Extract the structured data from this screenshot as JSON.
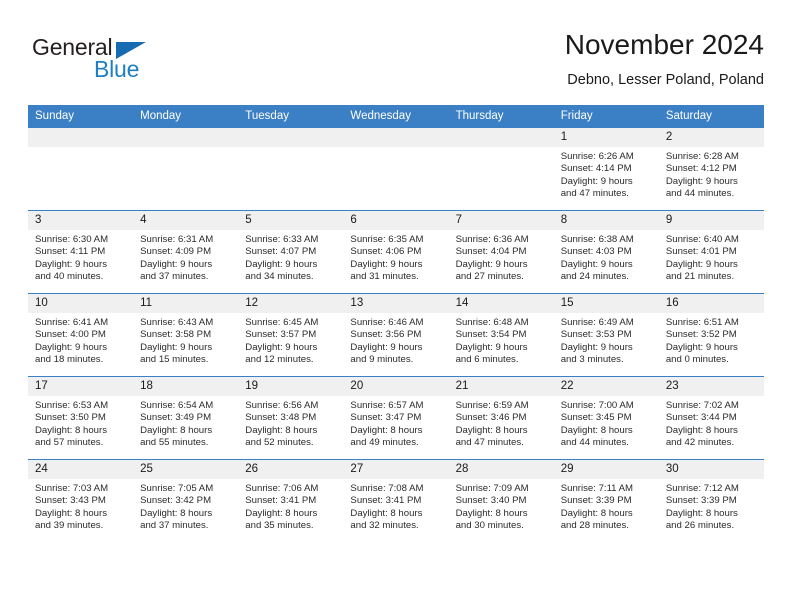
{
  "brand": {
    "name_top": "General",
    "name_bottom": "Blue",
    "triangle_icon": "blue-triangle-icon",
    "accent_color": "#1f7fc4"
  },
  "header": {
    "title": "November 2024",
    "subtitle": "Debno, Lesser Poland, Poland"
  },
  "theme": {
    "header_bg": "#3b7fc4",
    "header_text": "#ffffff",
    "daynum_bg": "#f0f0f0",
    "row_border": "#3b7fc4",
    "body_text": "#2b2b2b"
  },
  "calendar": {
    "weekday_headers": [
      "Sunday",
      "Monday",
      "Tuesday",
      "Wednesday",
      "Thursday",
      "Friday",
      "Saturday"
    ],
    "labels": {
      "sunrise": "Sunrise:",
      "sunset": "Sunset:",
      "daylight": "Daylight:"
    },
    "weeks": [
      [
        {
          "day": "",
          "empty": true
        },
        {
          "day": "",
          "empty": true
        },
        {
          "day": "",
          "empty": true
        },
        {
          "day": "",
          "empty": true
        },
        {
          "day": "",
          "empty": true
        },
        {
          "day": "1",
          "sunrise": "Sunrise: 6:26 AM",
          "sunset": "Sunset: 4:14 PM",
          "daylight_line1": "Daylight: 9 hours",
          "daylight_line2": "and 47 minutes."
        },
        {
          "day": "2",
          "sunrise": "Sunrise: 6:28 AM",
          "sunset": "Sunset: 4:12 PM",
          "daylight_line1": "Daylight: 9 hours",
          "daylight_line2": "and 44 minutes."
        }
      ],
      [
        {
          "day": "3",
          "sunrise": "Sunrise: 6:30 AM",
          "sunset": "Sunset: 4:11 PM",
          "daylight_line1": "Daylight: 9 hours",
          "daylight_line2": "and 40 minutes."
        },
        {
          "day": "4",
          "sunrise": "Sunrise: 6:31 AM",
          "sunset": "Sunset: 4:09 PM",
          "daylight_line1": "Daylight: 9 hours",
          "daylight_line2": "and 37 minutes."
        },
        {
          "day": "5",
          "sunrise": "Sunrise: 6:33 AM",
          "sunset": "Sunset: 4:07 PM",
          "daylight_line1": "Daylight: 9 hours",
          "daylight_line2": "and 34 minutes."
        },
        {
          "day": "6",
          "sunrise": "Sunrise: 6:35 AM",
          "sunset": "Sunset: 4:06 PM",
          "daylight_line1": "Daylight: 9 hours",
          "daylight_line2": "and 31 minutes."
        },
        {
          "day": "7",
          "sunrise": "Sunrise: 6:36 AM",
          "sunset": "Sunset: 4:04 PM",
          "daylight_line1": "Daylight: 9 hours",
          "daylight_line2": "and 27 minutes."
        },
        {
          "day": "8",
          "sunrise": "Sunrise: 6:38 AM",
          "sunset": "Sunset: 4:03 PM",
          "daylight_line1": "Daylight: 9 hours",
          "daylight_line2": "and 24 minutes."
        },
        {
          "day": "9",
          "sunrise": "Sunrise: 6:40 AM",
          "sunset": "Sunset: 4:01 PM",
          "daylight_line1": "Daylight: 9 hours",
          "daylight_line2": "and 21 minutes."
        }
      ],
      [
        {
          "day": "10",
          "sunrise": "Sunrise: 6:41 AM",
          "sunset": "Sunset: 4:00 PM",
          "daylight_line1": "Daylight: 9 hours",
          "daylight_line2": "and 18 minutes."
        },
        {
          "day": "11",
          "sunrise": "Sunrise: 6:43 AM",
          "sunset": "Sunset: 3:58 PM",
          "daylight_line1": "Daylight: 9 hours",
          "daylight_line2": "and 15 minutes."
        },
        {
          "day": "12",
          "sunrise": "Sunrise: 6:45 AM",
          "sunset": "Sunset: 3:57 PM",
          "daylight_line1": "Daylight: 9 hours",
          "daylight_line2": "and 12 minutes."
        },
        {
          "day": "13",
          "sunrise": "Sunrise: 6:46 AM",
          "sunset": "Sunset: 3:56 PM",
          "daylight_line1": "Daylight: 9 hours",
          "daylight_line2": "and 9 minutes."
        },
        {
          "day": "14",
          "sunrise": "Sunrise: 6:48 AM",
          "sunset": "Sunset: 3:54 PM",
          "daylight_line1": "Daylight: 9 hours",
          "daylight_line2": "and 6 minutes."
        },
        {
          "day": "15",
          "sunrise": "Sunrise: 6:49 AM",
          "sunset": "Sunset: 3:53 PM",
          "daylight_line1": "Daylight: 9 hours",
          "daylight_line2": "and 3 minutes."
        },
        {
          "day": "16",
          "sunrise": "Sunrise: 6:51 AM",
          "sunset": "Sunset: 3:52 PM",
          "daylight_line1": "Daylight: 9 hours",
          "daylight_line2": "and 0 minutes."
        }
      ],
      [
        {
          "day": "17",
          "sunrise": "Sunrise: 6:53 AM",
          "sunset": "Sunset: 3:50 PM",
          "daylight_line1": "Daylight: 8 hours",
          "daylight_line2": "and 57 minutes."
        },
        {
          "day": "18",
          "sunrise": "Sunrise: 6:54 AM",
          "sunset": "Sunset: 3:49 PM",
          "daylight_line1": "Daylight: 8 hours",
          "daylight_line2": "and 55 minutes."
        },
        {
          "day": "19",
          "sunrise": "Sunrise: 6:56 AM",
          "sunset": "Sunset: 3:48 PM",
          "daylight_line1": "Daylight: 8 hours",
          "daylight_line2": "and 52 minutes."
        },
        {
          "day": "20",
          "sunrise": "Sunrise: 6:57 AM",
          "sunset": "Sunset: 3:47 PM",
          "daylight_line1": "Daylight: 8 hours",
          "daylight_line2": "and 49 minutes."
        },
        {
          "day": "21",
          "sunrise": "Sunrise: 6:59 AM",
          "sunset": "Sunset: 3:46 PM",
          "daylight_line1": "Daylight: 8 hours",
          "daylight_line2": "and 47 minutes."
        },
        {
          "day": "22",
          "sunrise": "Sunrise: 7:00 AM",
          "sunset": "Sunset: 3:45 PM",
          "daylight_line1": "Daylight: 8 hours",
          "daylight_line2": "and 44 minutes."
        },
        {
          "day": "23",
          "sunrise": "Sunrise: 7:02 AM",
          "sunset": "Sunset: 3:44 PM",
          "daylight_line1": "Daylight: 8 hours",
          "daylight_line2": "and 42 minutes."
        }
      ],
      [
        {
          "day": "24",
          "sunrise": "Sunrise: 7:03 AM",
          "sunset": "Sunset: 3:43 PM",
          "daylight_line1": "Daylight: 8 hours",
          "daylight_line2": "and 39 minutes."
        },
        {
          "day": "25",
          "sunrise": "Sunrise: 7:05 AM",
          "sunset": "Sunset: 3:42 PM",
          "daylight_line1": "Daylight: 8 hours",
          "daylight_line2": "and 37 minutes."
        },
        {
          "day": "26",
          "sunrise": "Sunrise: 7:06 AM",
          "sunset": "Sunset: 3:41 PM",
          "daylight_line1": "Daylight: 8 hours",
          "daylight_line2": "and 35 minutes."
        },
        {
          "day": "27",
          "sunrise": "Sunrise: 7:08 AM",
          "sunset": "Sunset: 3:41 PM",
          "daylight_line1": "Daylight: 8 hours",
          "daylight_line2": "and 32 minutes."
        },
        {
          "day": "28",
          "sunrise": "Sunrise: 7:09 AM",
          "sunset": "Sunset: 3:40 PM",
          "daylight_line1": "Daylight: 8 hours",
          "daylight_line2": "and 30 minutes."
        },
        {
          "day": "29",
          "sunrise": "Sunrise: 7:11 AM",
          "sunset": "Sunset: 3:39 PM",
          "daylight_line1": "Daylight: 8 hours",
          "daylight_line2": "and 28 minutes."
        },
        {
          "day": "30",
          "sunrise": "Sunrise: 7:12 AM",
          "sunset": "Sunset: 3:39 PM",
          "daylight_line1": "Daylight: 8 hours",
          "daylight_line2": "and 26 minutes."
        }
      ]
    ]
  }
}
